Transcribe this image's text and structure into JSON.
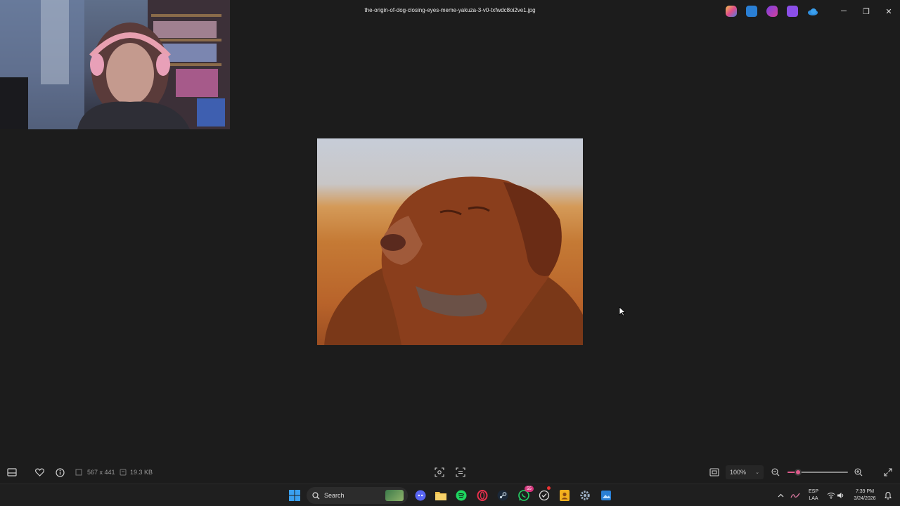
{
  "window": {
    "filename": "the-origin-of-dog-closing-eyes-meme-yakuza-3-v0-txfwdc8oi2ve1.jpg",
    "controls": {
      "minimize": "─",
      "maximize": "❐",
      "close": "✕"
    },
    "toolbar_icons": [
      "copilot-icon",
      "photos-edit-icon",
      "clipchamp-icon",
      "designer-icon",
      "onedrive-icon"
    ]
  },
  "image_info": {
    "dimensions": "567 x 441",
    "file_size": "19.3 KB"
  },
  "zoom": {
    "level": "100%",
    "slider_fraction": 0.18
  },
  "taskbar": {
    "search_label": "Search",
    "language": "ESP",
    "layout": "LAA",
    "time": "7:39 PM",
    "date": "3/24/2026",
    "whatsapp_badge": "55"
  },
  "colors": {
    "accent": "#e05a8c",
    "background": "#1c1c1c",
    "taskbar": "#1f1f1f"
  }
}
